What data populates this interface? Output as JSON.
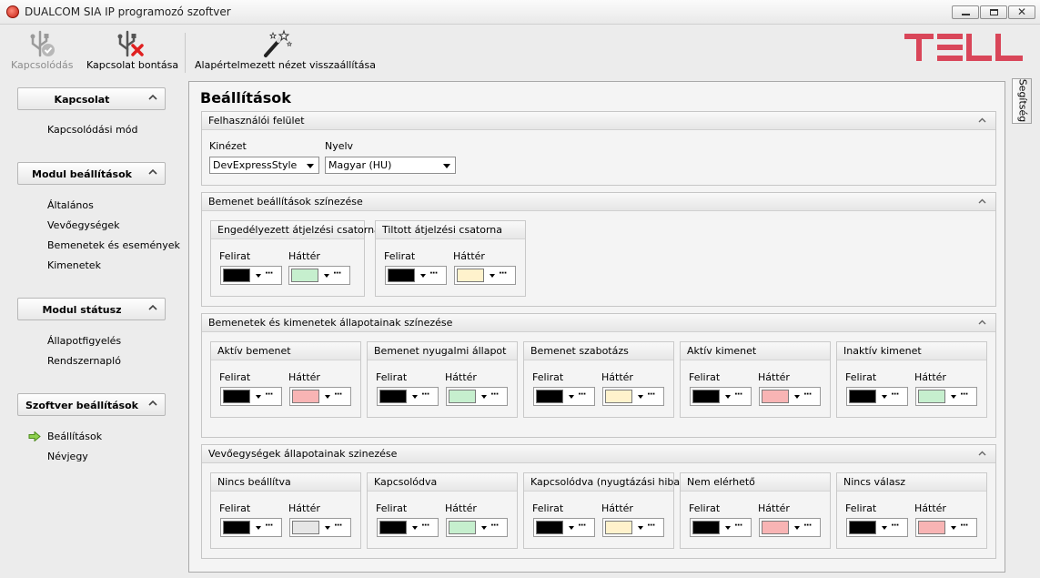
{
  "window": {
    "title": "DUALCOM SIA IP programozó szoftver"
  },
  "toolbar": {
    "connect_label": "Kapcsolódás",
    "disconnect_label": "Kapcsolat bontása",
    "reset_view_label": "Alapértelmezett nézet visszaállítása"
  },
  "logo": {
    "text": "TELL",
    "color": "#d94659"
  },
  "sidebar": {
    "sections": [
      {
        "label": "Kapcsolat",
        "items": [
          "Kapcsolódási mód"
        ]
      },
      {
        "label": "Modul beállítások",
        "items": [
          "Általános",
          "Vevőegységek",
          "Bemenetek és események",
          "Kimenetek"
        ]
      },
      {
        "label": "Modul státusz",
        "items": [
          "Állapotfigyelés",
          "Rendszernapló"
        ]
      },
      {
        "label": "Szoftver beállítások",
        "items": [
          "Beállítások",
          "Névjegy"
        ]
      }
    ],
    "active_item": "Beállítások"
  },
  "help_tab": {
    "label": "Segítség"
  },
  "main": {
    "title": "Beállítások",
    "ui_group": {
      "title": "Felhasználói felület",
      "skin_label": "Kinézet",
      "skin_value": "DevExpressStyle",
      "lang_label": "Nyelv",
      "lang_value": "Magyar (HU)"
    },
    "labels": {
      "caption": "Felirat",
      "background": "Háttér"
    },
    "input_color_group": {
      "title": "Bemenet beállítások színezése",
      "subgroups": [
        {
          "title": "Engedélyezett átjelzési csatorna",
          "caption_color": "#000000",
          "bg_color": "#c6efce"
        },
        {
          "title": "Tiltott átjelzési csatorna",
          "caption_color": "#000000",
          "bg_color": "#fff2cc"
        }
      ]
    },
    "io_state_group": {
      "title": "Bemenetek és kimenetek állapotainak színezése",
      "subgroups": [
        {
          "title": "Aktív bemenet",
          "caption_color": "#000000",
          "bg_color": "#f8b4b4"
        },
        {
          "title": "Bemenet nyugalmi állapot",
          "caption_color": "#000000",
          "bg_color": "#c6efce"
        },
        {
          "title": "Bemenet szabotázs",
          "caption_color": "#000000",
          "bg_color": "#fff2cc"
        },
        {
          "title": "Aktív kimenet",
          "caption_color": "#000000",
          "bg_color": "#f8b4b4"
        },
        {
          "title": "Inaktív kimenet",
          "caption_color": "#000000",
          "bg_color": "#c6efce"
        }
      ]
    },
    "receiver_group": {
      "title": "Vevőegységek állapotainak szinezése",
      "subgroups": [
        {
          "title": "Nincs beállítva",
          "caption_color": "#000000",
          "bg_color": "#e6e6e6"
        },
        {
          "title": "Kapcsolódva",
          "caption_color": "#000000",
          "bg_color": "#c6efce"
        },
        {
          "title": "Kapcsolódva (nyugtázási hiba)",
          "caption_color": "#000000",
          "bg_color": "#fff2cc"
        },
        {
          "title": "Nem elérhető",
          "caption_color": "#000000",
          "bg_color": "#f8b4b4"
        },
        {
          "title": "Nincs válasz",
          "caption_color": "#000000",
          "bg_color": "#f8b4b4"
        }
      ]
    }
  }
}
